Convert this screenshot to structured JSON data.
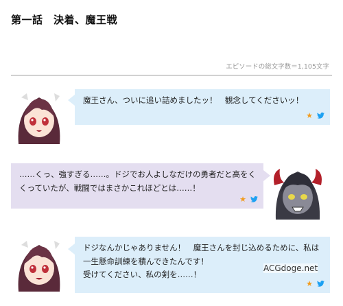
{
  "page": {
    "title": "第一話　決着、魔王戦",
    "char_count": "エピソードの総文字数＝1,105文字"
  },
  "dialogues": [
    {
      "speaker": "hero-girl",
      "text": "魔王さん、ついに追い詰めましたッ！　観念してくださいッ！"
    },
    {
      "speaker": "demon-king",
      "text": "……くっ、強すぎる……。ドジでお人よしなだけの勇者だと高をく\nくっていたが、戦闘ではまさかこれほどとは……！"
    },
    {
      "speaker": "hero-girl",
      "text": "ドジなんかじゃありません！　魔王さんを封じ込めるために、私は\n一生懸命訓練を積んできたんです！\n受けてください、私の剣を……！"
    }
  ],
  "icons": {
    "favorite": "star-icon",
    "share": "twitter-bird-icon"
  },
  "colors": {
    "blue_bubble": "#dceefa",
    "purple_bubble": "#e4def0",
    "star": "#f29b1c",
    "twitter": "#1da1f2"
  },
  "watermark": "ACGdoge.net"
}
